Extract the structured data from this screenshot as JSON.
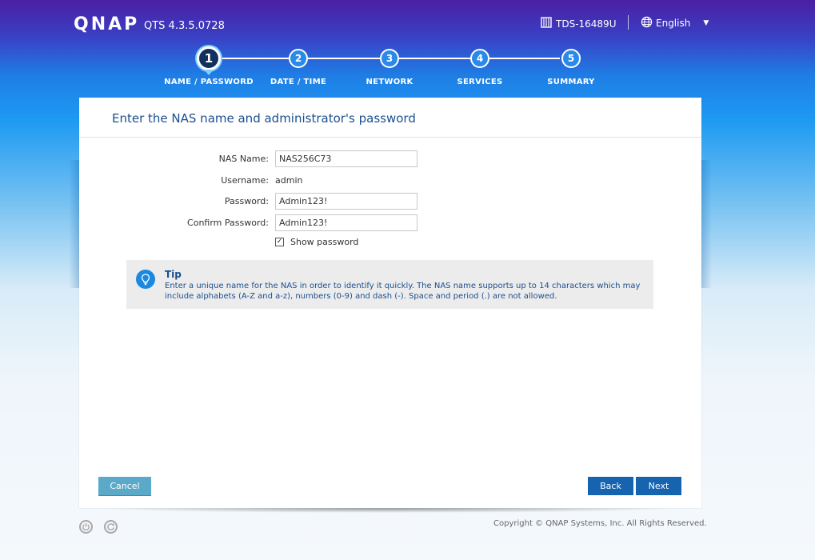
{
  "header": {
    "logo": "QNAP",
    "version": "QTS 4.3.5.0728",
    "device_name": "TDS-16489U",
    "language": "English"
  },
  "steps": [
    {
      "number": "1",
      "label": "NAME / PASSWORD",
      "active": true
    },
    {
      "number": "2",
      "label": "DATE / TIME",
      "active": false
    },
    {
      "number": "3",
      "label": "NETWORK",
      "active": false
    },
    {
      "number": "4",
      "label": "SERVICES",
      "active": false
    },
    {
      "number": "5",
      "label": "SUMMARY",
      "active": false
    }
  ],
  "panel": {
    "title": "Enter the NAS name and administrator's password",
    "fields": {
      "nas_name_label": "NAS Name:",
      "nas_name_value": "NAS256C73",
      "username_label": "Username:",
      "username_value": "admin",
      "password_label": "Password:",
      "password_value": "Admin123!",
      "confirm_label": "Confirm Password:",
      "confirm_value": "Admin123!"
    },
    "show_password_label": "Show password",
    "show_password_checked": true,
    "tip": {
      "title": "Tip",
      "text": "Enter a unique name for the NAS in order to identify it quickly. The NAS name supports up to 14 characters which may include alphabets (A-Z and a-z), numbers (0-9) and dash (-). Space and period (.) are not allowed."
    },
    "buttons": {
      "cancel": "Cancel",
      "back": "Back",
      "next": "Next"
    }
  },
  "footer": {
    "copyright": "Copyright © QNAP Systems, Inc. All Rights Reserved."
  },
  "colors": {
    "accent": "#1663b0",
    "title": "#1b4f8f",
    "cancel": "#5aa9c9"
  },
  "icons": [
    "server-icon",
    "globe-icon",
    "lightbulb-icon",
    "power-icon",
    "refresh-icon"
  ]
}
